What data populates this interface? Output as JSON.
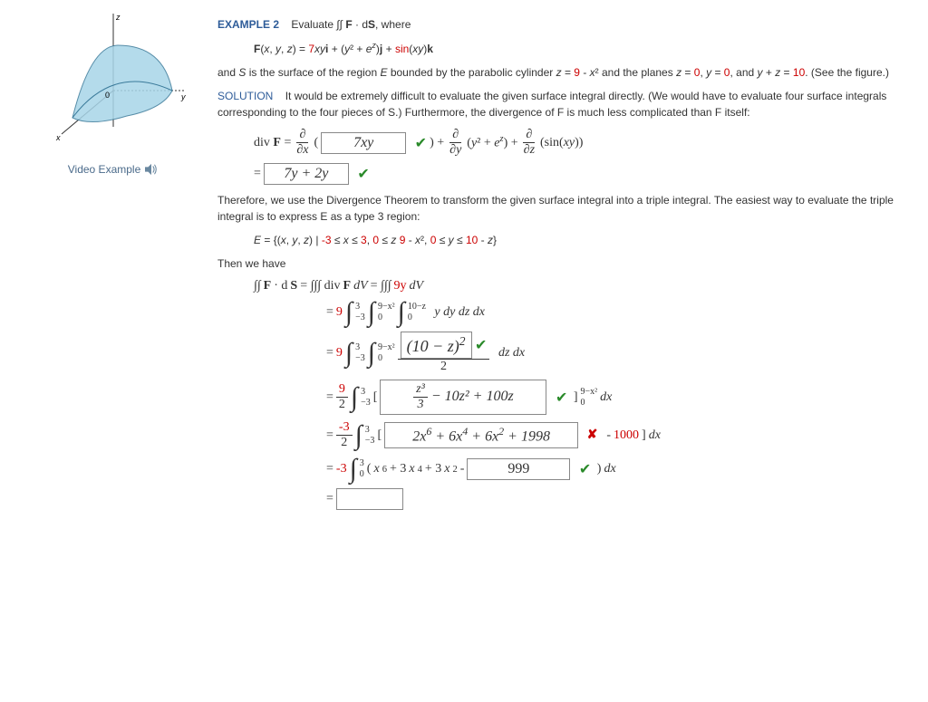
{
  "video_link_text": "Video Example",
  "example_label": "EXAMPLE 2",
  "prompt_text": "Evaluate ∫∫ F · dS, where",
  "vector_field": {
    "lhs": "F(x, y, z) = ",
    "term1_coef": "7",
    "term1": "xy",
    "term1_unit": "i",
    "term2": "(y² + eᶻ)",
    "term2_unit": "j",
    "term3_sin": "sin",
    "term3_arg": "(xy)",
    "term3_unit": "k"
  },
  "surface_desc1": "and S is the surface of the region E bounded by the parabolic cylinder z = ",
  "parabola_const": "9",
  "surface_desc1b": " - x² and the planes z = ",
  "plane_z": "0",
  "plane_y": "0",
  "surface_desc2": "and y + z = ",
  "plane_yz": "10",
  "surface_desc2b": ". (See the figure.)",
  "solution_label": "SOLUTION",
  "solution_text": "It would be extremely difficult to evaluate the given surface integral directly. (We would have to evaluate four surface integrals corresponding to the four pieces of S.) Furthermore, the divergence of F is much less complicated than F itself:",
  "div_line": {
    "lhs": "div F = ",
    "input1": "7xy",
    "mid1": "(y² + eᶻ)",
    "mid2": "(sin(xy))",
    "input2": "7y + 2y"
  },
  "therefore_text": "Therefore, we use the Divergence Theorem to transform the given surface integral into a triple integral. The easiest way to evaluate the triple integral is to express E as a type 3 region:",
  "region_E": {
    "prefix": "E = {(x, y, z) | ",
    "x_lo": "-3",
    "x_hi": "3",
    "z_hi_const": "9",
    "y_hi_const": "10",
    "suffix": " - z}"
  },
  "then_we_have": "Then we have",
  "integral_header": "∫∫ F · dS = ∫∫∫ div F dV = ∫∫∫ ",
  "integral_header_val": "9y",
  "integral_header_dv": " dV",
  "step1": {
    "coef": "9",
    "x_lo": "−3",
    "x_hi": "3",
    "z_lo": "0",
    "z_hi": "9−x²",
    "y_lo": "0",
    "y_hi": "10−z",
    "body": "y dy dz dx"
  },
  "step2": {
    "coef": "9",
    "x_lo": "−3",
    "x_hi": "3",
    "z_lo": "0",
    "z_hi": "9−x²",
    "input": "(10 − z)²",
    "denom": "2",
    "tail": "dz dx"
  },
  "step3": {
    "coef_num": "9",
    "coef_den": "2",
    "x_lo": "−3",
    "x_hi": "3",
    "input": "z³/3 − 10z² + 100z",
    "input_num": "z³",
    "input_num_den": "3",
    "input_rest": " − 10z² + 100z",
    "eval_lo": "0",
    "eval_hi": "9−x²",
    "tail": "dx"
  },
  "step4": {
    "coef_num": "-3",
    "coef_den": "2",
    "x_lo": "−3",
    "x_hi": "3",
    "input": "2x⁶ + 6x⁴ + 6x² + 1998",
    "tail_num": "1000",
    "tail": "]dx"
  },
  "step5": {
    "coef": "-3",
    "lo": "0",
    "hi": "3",
    "body": "(x⁶ + 3x⁴ + 3x² - ",
    "input": "999",
    "tail": ") dx"
  }
}
